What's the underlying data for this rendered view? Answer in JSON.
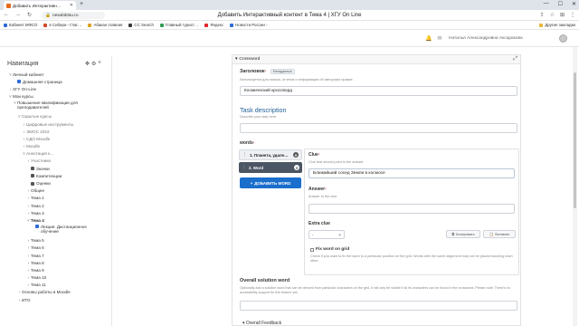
{
  "browser": {
    "tab_title": "Добавить Интерактивн…",
    "url": "newdoktsu.ru",
    "page_title": "Добавить Интерактивный контент в Тема 4 | ХГУ On Line"
  },
  "bookmarks": {
    "items": [
      {
        "label": "Кабинет МФСО",
        "color": "#2f6bd8"
      },
      {
        "label": "в Сибири - Глаг…",
        "color": "#d34a2c"
      },
      {
        "label": "Абакан главная",
        "color": "#e0a020"
      },
      {
        "label": "CC Search",
        "color": "#3a3a3a"
      },
      {
        "label": "Главный турист…",
        "color": "#2f9c54"
      },
      {
        "label": "Яндекс",
        "color": "#e0262a"
      },
      {
        "label": "Новости России -",
        "color": "#2f6bd8"
      }
    ],
    "other": "Другие закладки"
  },
  "header": {
    "username": "Наталья Александровна Аксаракова"
  },
  "drawer": {
    "title": "Навигация",
    "items": [
      {
        "label": "Личный кабинет",
        "indent": 1,
        "chev": "˅"
      },
      {
        "label": "Домашняя страница",
        "indent": 2,
        "chev": "",
        "icon": "#2f6bd8"
      },
      {
        "label": "ХГУ On-Line",
        "indent": 1,
        "chev": "›"
      },
      {
        "label": "Мои курсы",
        "indent": 1,
        "chev": "˅"
      },
      {
        "label": "Повышение квалификации для преподавателей",
        "indent": 2,
        "chev": "˅",
        "wrap": true
      },
      {
        "label": "Скрытые курсы",
        "indent": 3,
        "chev": "˅",
        "muted": true
      },
      {
        "label": "Цифровые инструменты",
        "indent": 4,
        "chev": "›",
        "muted": true
      },
      {
        "label": "ЭМОС 2022",
        "indent": 4,
        "chev": "›",
        "muted": true
      },
      {
        "label": "СДО Moodle",
        "indent": 4,
        "chev": "›",
        "muted": true
      },
      {
        "label": "Moodle",
        "indent": 4,
        "chev": "›",
        "muted": true
      },
      {
        "label": "Аннотация к…",
        "indent": 4,
        "chev": "˅",
        "muted": true
      },
      {
        "label": "Участники",
        "indent": 5,
        "chev": "›",
        "muted": true
      },
      {
        "label": "Значки",
        "indent": 5,
        "chev": "",
        "icon": "#555"
      },
      {
        "label": "Компетенции",
        "indent": 5,
        "chev": "",
        "icon": "#555"
      },
      {
        "label": "Оценки",
        "indent": 5,
        "chev": "",
        "icon": "#555"
      },
      {
        "label": "Общее",
        "indent": 5,
        "chev": "›"
      },
      {
        "label": "Тема 1",
        "indent": 5,
        "chev": "›"
      },
      {
        "label": "Тема 2",
        "indent": 5,
        "chev": "›"
      },
      {
        "label": "Тема 3",
        "indent": 5,
        "chev": "›"
      },
      {
        "label": "Тема 4",
        "indent": 5,
        "chev": "˅",
        "active": true
      },
      {
        "label": "Лекция. Дистанционное обучение",
        "indent": 6,
        "chev": "",
        "icon": "#2f6bd8",
        "wrap": true
      },
      {
        "label": "Тема 5",
        "indent": 5,
        "chev": "›"
      },
      {
        "label": "Тема 6",
        "indent": 5,
        "chev": "›"
      },
      {
        "label": "Тема 7",
        "indent": 5,
        "chev": "›"
      },
      {
        "label": "Тема 8",
        "indent": 5,
        "chev": "›"
      },
      {
        "label": "Тема 9",
        "indent": 5,
        "chev": "›"
      },
      {
        "label": "Тема 10",
        "indent": 5,
        "chev": "›"
      },
      {
        "label": "Тема 11",
        "indent": 5,
        "chev": "›"
      },
      {
        "label": "Основы работы в Moodle",
        "indent": 3,
        "chev": "›"
      },
      {
        "label": "ИТО",
        "indent": 3,
        "chev": "›"
      }
    ]
  },
  "form": {
    "section_title": "Crossword",
    "heading_label": "Заголовок",
    "heading_badge": "Метаданные",
    "heading_hint": "Используется для поиска, отчетов и информации об авторских правах",
    "heading_value": "Космический кроссворд",
    "task_title": "Task description",
    "task_hint": "Describe your task here.",
    "task_value": "",
    "words_label": "words",
    "words": [
      {
        "label": "1. Планета, удале…"
      },
      {
        "label": "2. Word"
      }
    ],
    "add_word": "ДОБАВИТЬ WORD",
    "clue_label": "Clue",
    "clue_hint": "Clue that should point to the answer.",
    "clue_value": "Ближайший сосед Земли в космосе",
    "answer_label": "Answer",
    "answer_hint": "Answer to the clue.",
    "answer_value": "",
    "extra_clue_label": "Extra clue",
    "extra_clue_value": "-",
    "copy_btn": "Копировать",
    "paste_btn": "Вставить",
    "fix_word_label": "Fix word on grid",
    "fix_word_hint": "Check if you want to fix the word to a particular position on the grid. Words with the same alignment may not be placed touching each other.",
    "overall_label": "Overall solution word",
    "overall_hint": "Optionally add a solution word that can be derived from particular characters on the grid. It will only be visible if all its characters can be found in the crossword. Please note: There's no accessibility support for this feature yet.",
    "overall_value": "",
    "overall_feedback": "Overall Feedback"
  }
}
